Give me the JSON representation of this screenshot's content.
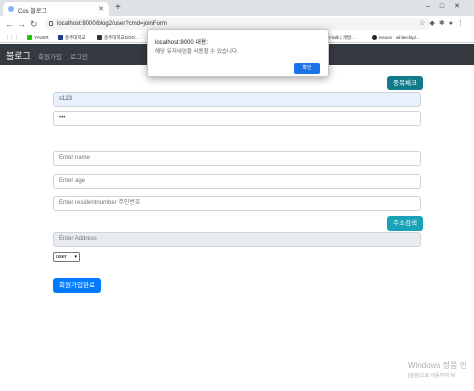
{
  "browser": {
    "tab_title": "Cos 블로그",
    "url": "localhost:8000/blog2/user?cmd=joinForm",
    "bookmarks": [
      "YAVER",
      "충주대학교",
      "충주대학교DOO...",
      "ck | 2-talk | 개발...",
      "Issues · whitechip/..."
    ]
  },
  "navbar": {
    "brand": "블로그",
    "links": [
      "회원가입",
      "로그인"
    ]
  },
  "form": {
    "dup_check_label": "중복체크",
    "username_value": "s123",
    "password_value": "•••",
    "name_placeholder": "Enter name",
    "age_placeholder": "Enter age",
    "resident_placeholder": "Enter residentnumber 주민번호",
    "address_search_label": "주소검색",
    "address_placeholder": "Enter Address",
    "select_value": "user",
    "submit_label": "회원가입완료"
  },
  "dialog": {
    "title": "localhost:8000 내용:",
    "message": "해당 유저네임을 사용할 수 있습니다.",
    "ok_label": "확인"
  },
  "watermark": {
    "line1": "Windows 정품 인",
    "line2": "[설정]으로 이동하여 W"
  },
  "colors": {
    "navbar_bg": "#343a40",
    "teal": "#17a2b8",
    "primary": "#007bff",
    "dialog_ok": "#1a73e8"
  }
}
